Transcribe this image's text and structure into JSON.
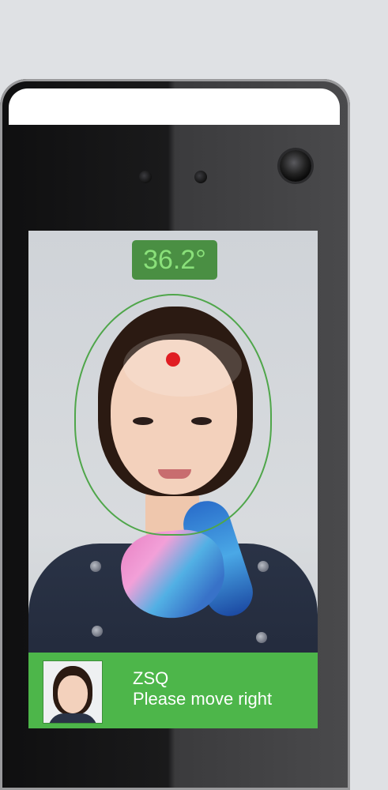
{
  "screen": {
    "temperature": "36.2°",
    "status": {
      "name": "ZSQ",
      "message": "Please move right"
    }
  },
  "colors": {
    "status_panel": "#4db64a",
    "temperature_badge": "#4a8f43",
    "face_outline": "#4fa64a",
    "target_dot": "#e01d22"
  },
  "icons": [
    "camera-lens",
    "ir-sensor",
    "light-sensor"
  ]
}
